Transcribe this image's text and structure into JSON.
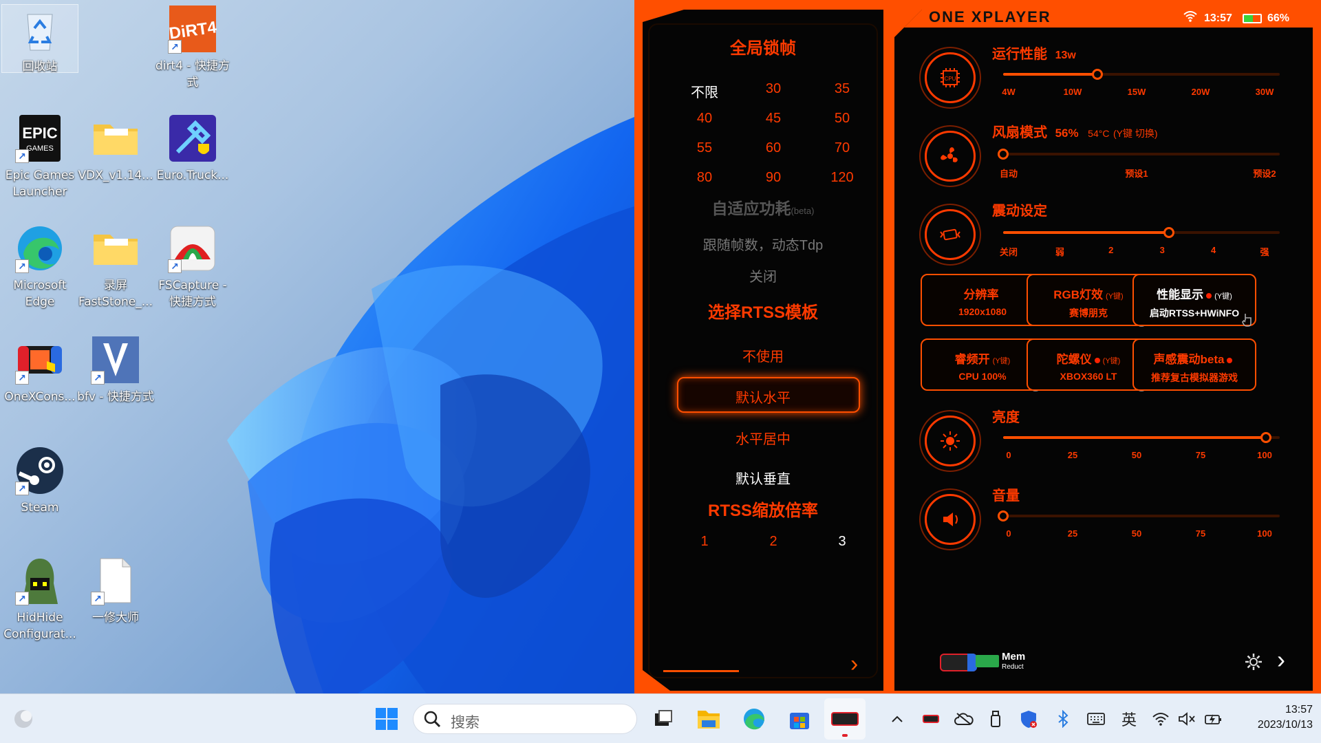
{
  "desktop": {
    "icons": [
      {
        "name": "recycle-bin",
        "label": "回收站"
      },
      {
        "name": "dirt4-shortcut",
        "label": "dirt4 - 快捷方式"
      },
      {
        "name": "epic-games-launcher",
        "label": "Epic Games Launcher"
      },
      {
        "name": "vdx-folder",
        "label": "VDX_v1.14..."
      },
      {
        "name": "euro-truck",
        "label": "Euro.Truck..."
      },
      {
        "name": "microsoft-edge",
        "label": "Microsoft Edge"
      },
      {
        "name": "faststone-folder",
        "label": "录屏 FastStone_..."
      },
      {
        "name": "fscapture-shortcut",
        "label": "FSCapture - 快捷方式"
      },
      {
        "name": "onexconsole",
        "label": "OneXCons..."
      },
      {
        "name": "bfv-shortcut",
        "label": "bfv - 快捷方式"
      },
      {
        "name": "steam",
        "label": "Steam"
      },
      {
        "name": "hidhide",
        "label": "HidHide Configurat..."
      },
      {
        "name": "yixiu-master",
        "label": "一修大师"
      }
    ]
  },
  "taskbar": {
    "search_placeholder": "搜索",
    "ime": "英",
    "time": "13:57",
    "date": "2023/10/13"
  },
  "onex": {
    "brand": "ONE XPLAYER",
    "status": {
      "time": "13:57",
      "battery": "66%"
    },
    "left": {
      "fps_title": "全局锁帧",
      "fps_options": [
        "不限",
        "30",
        "35",
        "40",
        "45",
        "50",
        "55",
        "60",
        "70",
        "80",
        "90",
        "120"
      ],
      "fps_selected": "不限",
      "adaptive_title": "自适应功耗",
      "adaptive_beta": "(beta)",
      "adaptive_follow": "跟随帧数，动态Tdp",
      "adaptive_off": "关闭",
      "rtss_title": "选择RTSS模板",
      "rtss_options": [
        "不使用",
        "默认水平",
        "水平居中",
        "默认垂直"
      ],
      "rtss_selected": "默认水平",
      "zoom_title": "RTSS缩放倍率",
      "zoom_options": [
        "1",
        "2",
        "3"
      ],
      "zoom_selected": "3"
    },
    "right": {
      "perf": {
        "title": "运行性能",
        "value": "13w",
        "ticks": [
          "4W",
          "10W",
          "15W",
          "20W",
          "30W"
        ],
        "level": 0.34
      },
      "fan": {
        "title": "风扇模式",
        "value": "56%",
        "temp": "54°C",
        "hint": "(Y键 切换)",
        "ticks": [
          "自动",
          "预设1",
          "预设2"
        ],
        "level": 0.0
      },
      "vibe": {
        "title": "震动设定",
        "ticks": [
          "关闭",
          "弱",
          "2",
          "3",
          "4",
          "强"
        ],
        "level": 0.6
      },
      "cards": [
        {
          "title": "分辨率",
          "sub": "1920x1080",
          "tag": ""
        },
        {
          "title": "RGB灯效",
          "sub": "赛博朋克",
          "tag": "(Y键)"
        },
        {
          "title": "性能显示",
          "sub": "启动RTSS+HWiNFO",
          "tag": "(Y键)"
        },
        {
          "title": "睿频开",
          "sub": "CPU 100%",
          "tag": "(Y键)"
        },
        {
          "title": "陀螺仪",
          "sub": "XBOX360 LT",
          "tag": "(Y键)"
        },
        {
          "title": "声感震动beta",
          "sub": "推荐复古模拟器游戏",
          "tag": ""
        }
      ],
      "brightness": {
        "title": "亮度",
        "ticks": [
          "0",
          "25",
          "50",
          "75",
          "100"
        ],
        "level": 0.95
      },
      "volume": {
        "title": "音量",
        "ticks": [
          "0",
          "25",
          "50",
          "75",
          "100"
        ],
        "level": 0.0
      },
      "mem_label": "Mem",
      "mem_sub": "Reduct"
    }
  },
  "colors": {
    "accent": "#ff4f00",
    "panel": "#050505",
    "text_orange": "#ff3a00"
  }
}
